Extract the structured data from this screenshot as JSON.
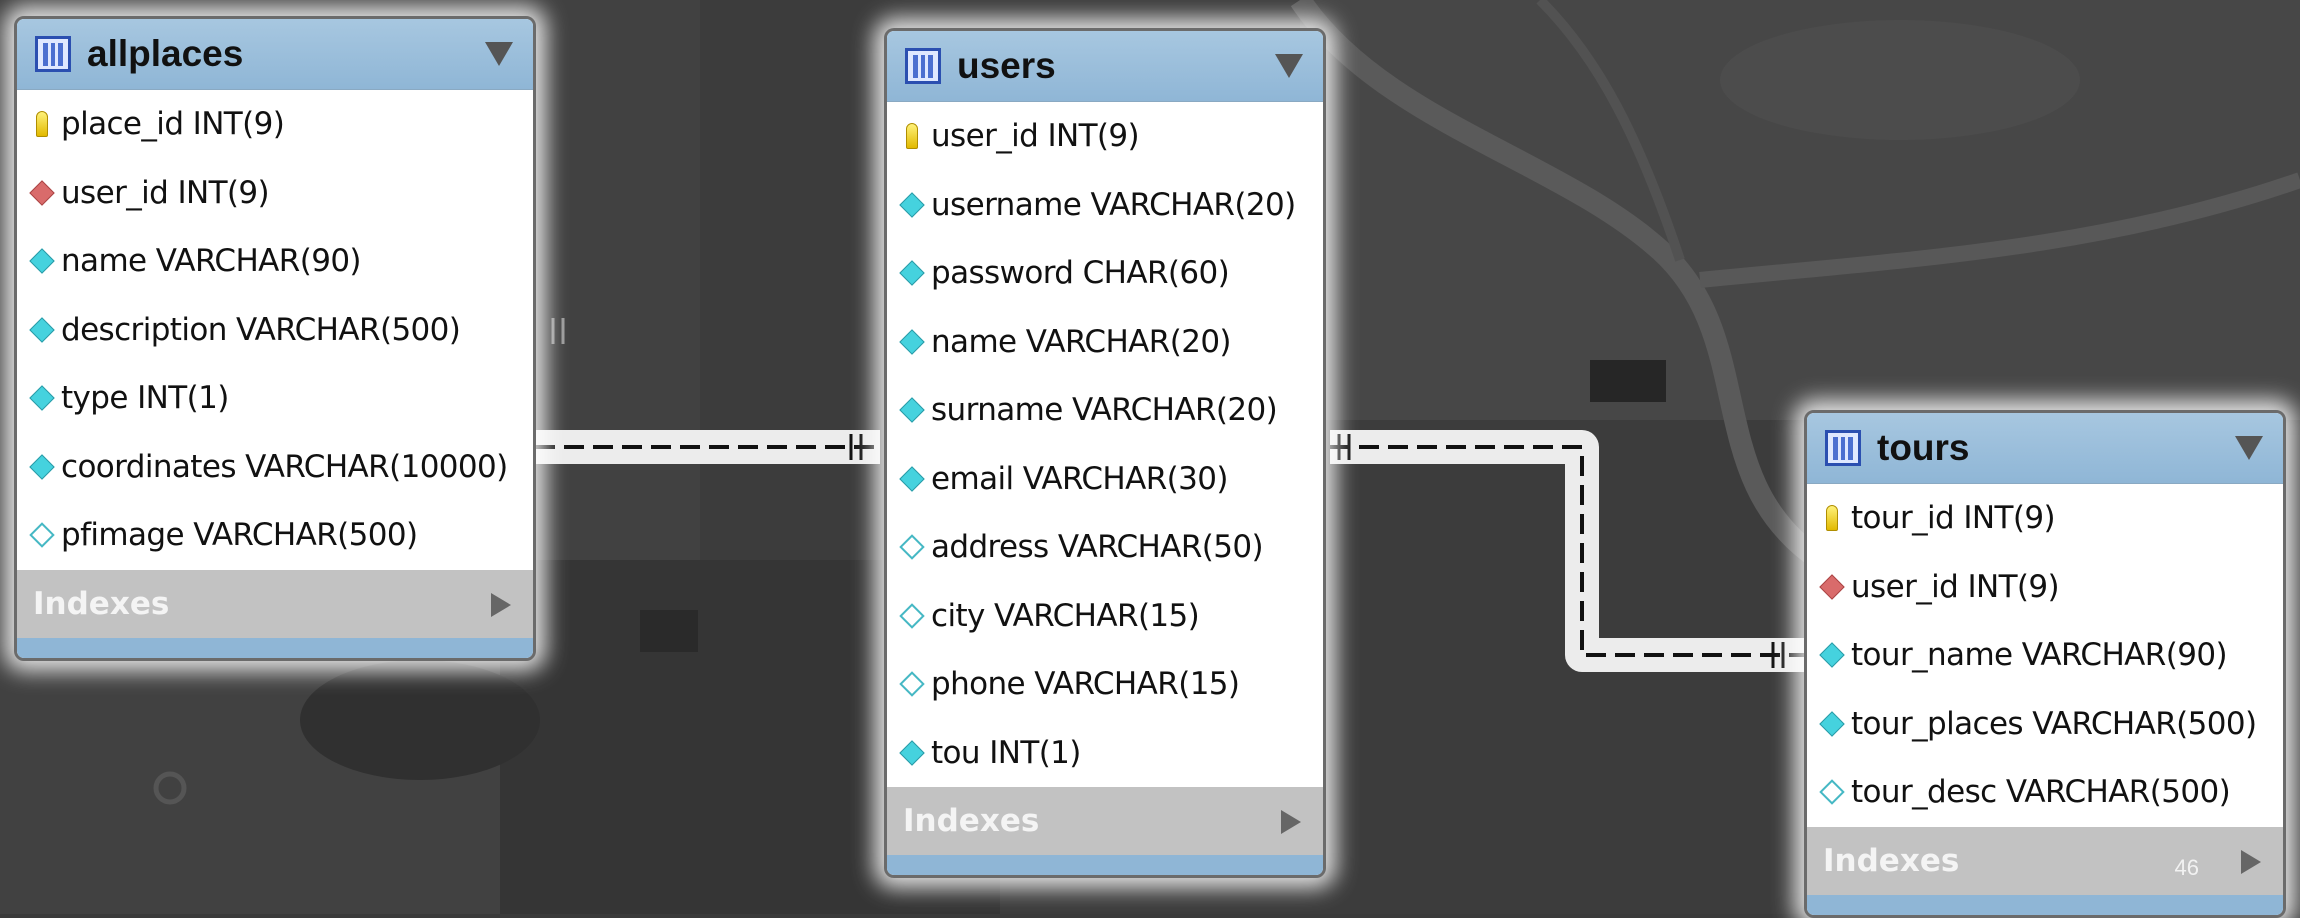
{
  "tables": {
    "allplaces": {
      "title": "allplaces",
      "columns": [
        {
          "kind": "pk",
          "text": "place_id INT(9)"
        },
        {
          "kind": "fk",
          "text": "user_id INT(9)"
        },
        {
          "kind": "nn",
          "text": "name VARCHAR(90)"
        },
        {
          "kind": "nn",
          "text": "description VARCHAR(500)"
        },
        {
          "kind": "nn",
          "text": "type INT(1)"
        },
        {
          "kind": "nn",
          "text": "coordinates VARCHAR(10000)"
        },
        {
          "kind": "null",
          "text": "pfimage VARCHAR(500)"
        }
      ],
      "indexes_label": "Indexes"
    },
    "users": {
      "title": "users",
      "columns": [
        {
          "kind": "pk",
          "text": "user_id INT(9)"
        },
        {
          "kind": "nn",
          "text": "username VARCHAR(20)"
        },
        {
          "kind": "nn",
          "text": "password CHAR(60)"
        },
        {
          "kind": "nn",
          "text": "name VARCHAR(20)"
        },
        {
          "kind": "nn",
          "text": "surname VARCHAR(20)"
        },
        {
          "kind": "nn",
          "text": "email VARCHAR(30)"
        },
        {
          "kind": "null",
          "text": "address VARCHAR(50)"
        },
        {
          "kind": "null",
          "text": "city VARCHAR(15)"
        },
        {
          "kind": "null",
          "text": "phone VARCHAR(15)"
        },
        {
          "kind": "nn",
          "text": "tou INT(1)"
        }
      ],
      "indexes_label": "Indexes"
    },
    "tours": {
      "title": "tours",
      "columns": [
        {
          "kind": "pk",
          "text": "tour_id INT(9)"
        },
        {
          "kind": "fk",
          "text": "user_id INT(9)"
        },
        {
          "kind": "nn",
          "text": "tour_name VARCHAR(90)"
        },
        {
          "kind": "nn",
          "text": "tour_places VARCHAR(500)"
        },
        {
          "kind": "null",
          "text": "tour_desc VARCHAR(500)"
        }
      ],
      "indexes_label": "Indexes"
    }
  },
  "page_number": "46",
  "icons": {
    "table": "table-icon",
    "header_toggle": "triangle-down-icon",
    "indexes_toggle": "triangle-right-icon",
    "primary_key": "key-icon",
    "foreign_key": "red-diamond-icon",
    "not_null": "filled-diamond-icon",
    "nullable": "hollow-diamond-icon"
  },
  "colors": {
    "header": "#a7c7e0",
    "indexes_bar": "#c2c2c2",
    "connector": "#111111",
    "background": "#3a3a3a"
  }
}
